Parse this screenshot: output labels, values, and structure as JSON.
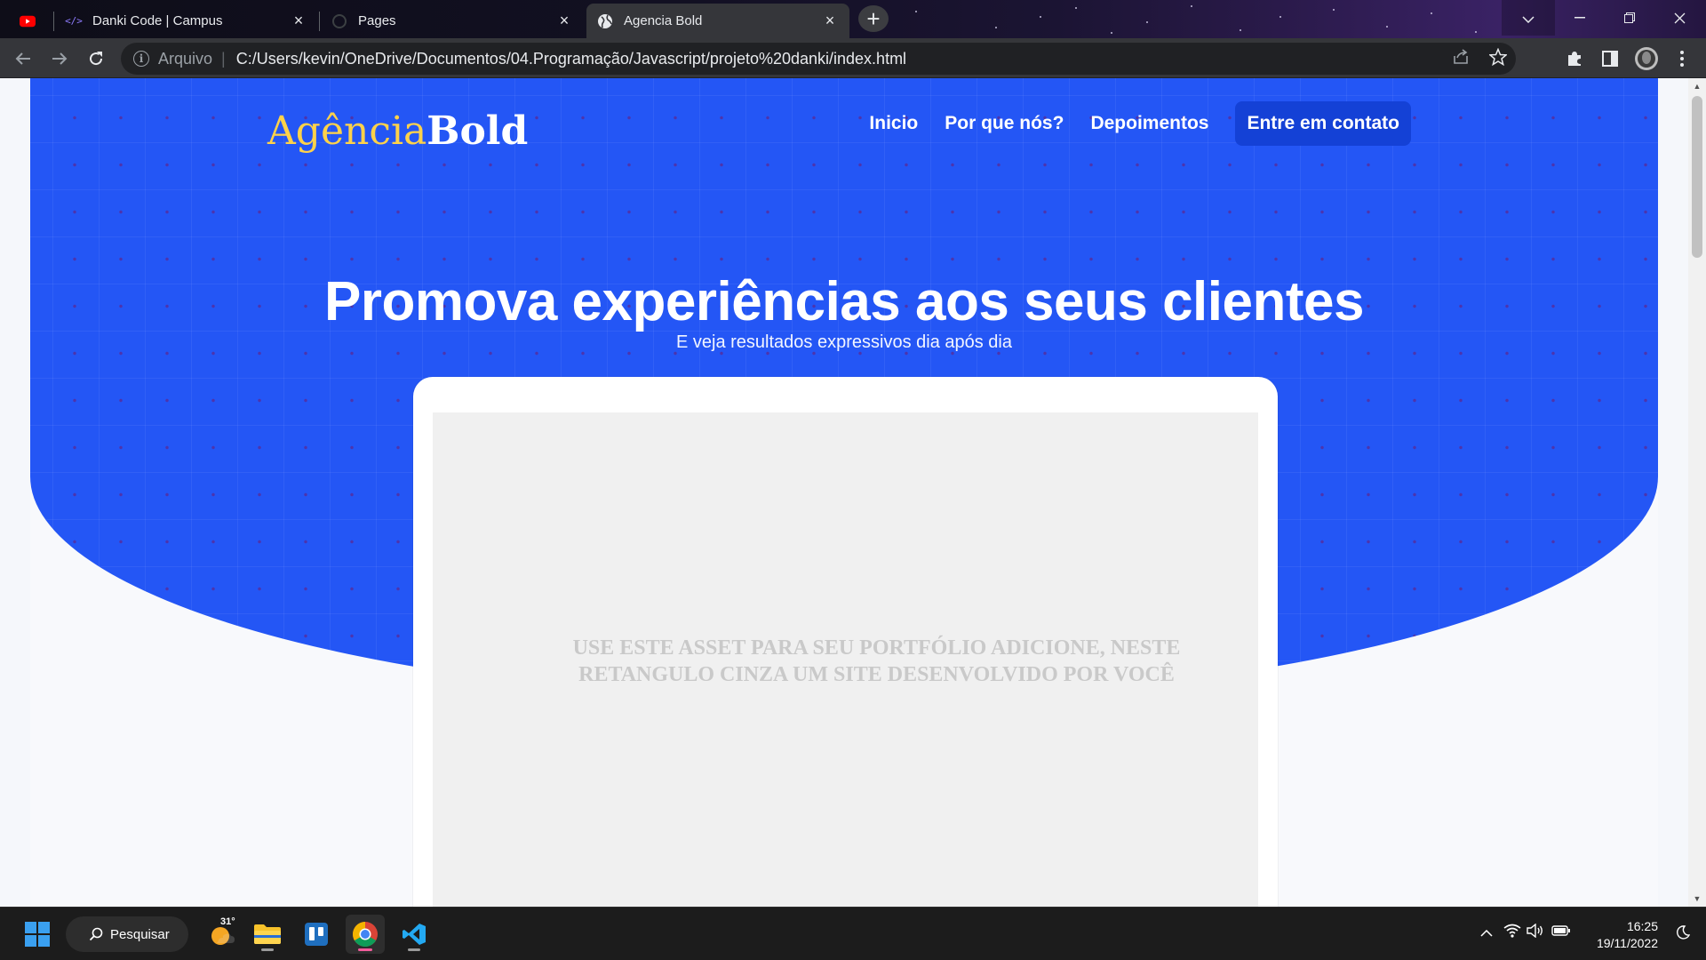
{
  "browser": {
    "tabs": [
      {
        "title": "",
        "favicon": "youtube-icon",
        "active": false
      },
      {
        "title": "Danki Code | Campus",
        "favicon": "code-icon",
        "active": false
      },
      {
        "title": "Pages",
        "favicon": "loading-icon",
        "active": false
      },
      {
        "title": "Agencia Bold",
        "favicon": "globe-icon",
        "active": true
      }
    ],
    "address": {
      "scheme_label": "Arquivo",
      "url": "C:/Users/kevin/OneDrive/Documentos/04.Programação/Javascript/projeto%20danki/index.html"
    }
  },
  "site": {
    "logo": {
      "part1": "Agência",
      "part2": "Bold"
    },
    "nav": {
      "item1": "Inicio",
      "item2": "Por que nós?",
      "item3": "Depoimentos",
      "cta": "Entre em contato"
    },
    "hero": {
      "title": "Promova experiências aos seus clientes",
      "subtitle": "E veja resultados expressivos dia após dia"
    },
    "mockup_placeholder": "USE ESTE ASSET PARA SEU PORTFÓLIO ADICIONE, NESTE RETANGULO CINZA UM SITE DESENVOLVIDO POR VOCÊ",
    "colors": {
      "hero_blue": "#2456f5",
      "logo_yellow": "#ffd24a",
      "cta_blue": "#1441d6"
    }
  },
  "taskbar": {
    "search_label": "Pesquisar",
    "weather_temp": "31°",
    "time": "16:25",
    "date": "19/11/2022"
  }
}
